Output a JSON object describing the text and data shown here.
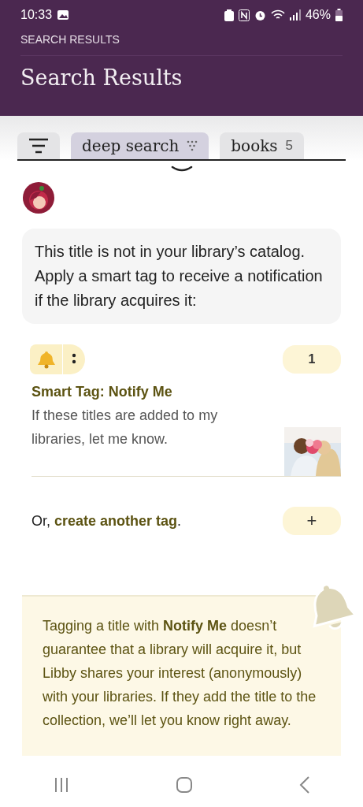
{
  "status_bar": {
    "time": "10:33",
    "battery": "46%"
  },
  "header": {
    "eyebrow": "SEARCH RESULTS",
    "title": "Search Results"
  },
  "tabs": [
    {
      "kind": "menu",
      "selected": false
    },
    {
      "kind": "text",
      "label": "deep search",
      "selected": true
    },
    {
      "kind": "count",
      "label": "books",
      "count": "5",
      "selected": false
    }
  ],
  "message": "This title is not in your library’s catalog. Apply a smart tag to receive a notification if the library acquires it:",
  "smart_tag": {
    "count": "1",
    "title": "Smart Tag: Notify Me",
    "description": "If these titles are added to my libraries, let me know."
  },
  "create": {
    "prefix": "Or, ",
    "link": "create another tag",
    "suffix": ".",
    "button": "+"
  },
  "info": "Tagging a title with **Notify Me** doesn’t guarantee that a library will acquire it, but Libby shares your interest (anonymously) with your libraries. If they add the title to the collection, we’ll let you know right away."
}
